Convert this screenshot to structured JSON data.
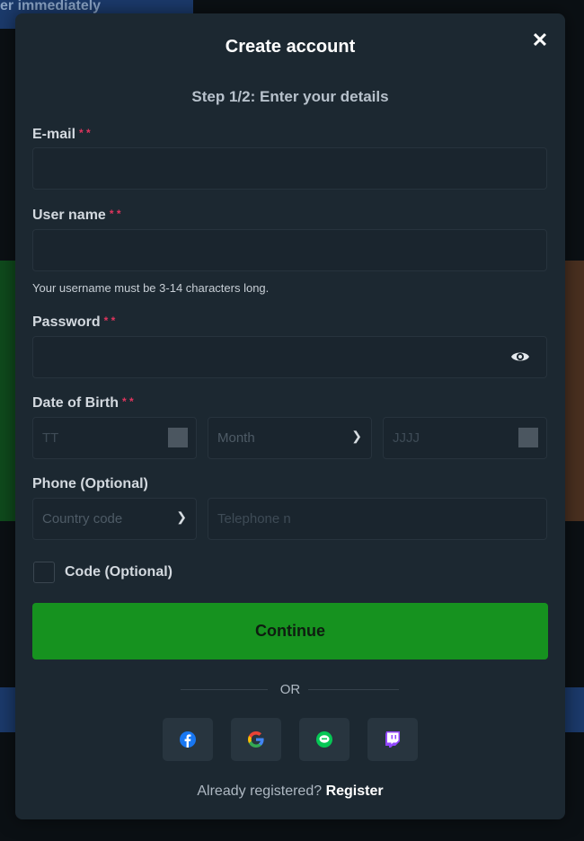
{
  "background": {
    "banner_text": "er immediately"
  },
  "modal": {
    "title": "Create account",
    "close_icon": "close-icon",
    "step": "Step 1/2: Enter your details",
    "required_mark": "* *",
    "email": {
      "label": "E-mail",
      "value": "",
      "placeholder": ""
    },
    "username": {
      "label": "User name",
      "value": "",
      "placeholder": "",
      "hint": "Your username must be 3-14 characters long."
    },
    "password": {
      "label": "Password",
      "value": "",
      "icon": "eye-icon"
    },
    "dob": {
      "label": "Date of Birth",
      "day_placeholder": "TT",
      "month_placeholder": "Month",
      "year_placeholder": "JJJJ"
    },
    "phone": {
      "label": "Phone (Optional)",
      "country_placeholder": "Country code",
      "number_placeholder": "Telephone n"
    },
    "code": {
      "label": "Code (Optional)",
      "checked": false
    },
    "continue_label": "Continue",
    "or_label": "OR",
    "social": [
      {
        "name": "facebook",
        "color": "#1877f2"
      },
      {
        "name": "google",
        "color": "#4285f4"
      },
      {
        "name": "line",
        "color": "#06c755"
      },
      {
        "name": "twitch",
        "color": "#9146ff"
      }
    ],
    "footer": {
      "text": "Already registered?",
      "link": "Register"
    }
  }
}
